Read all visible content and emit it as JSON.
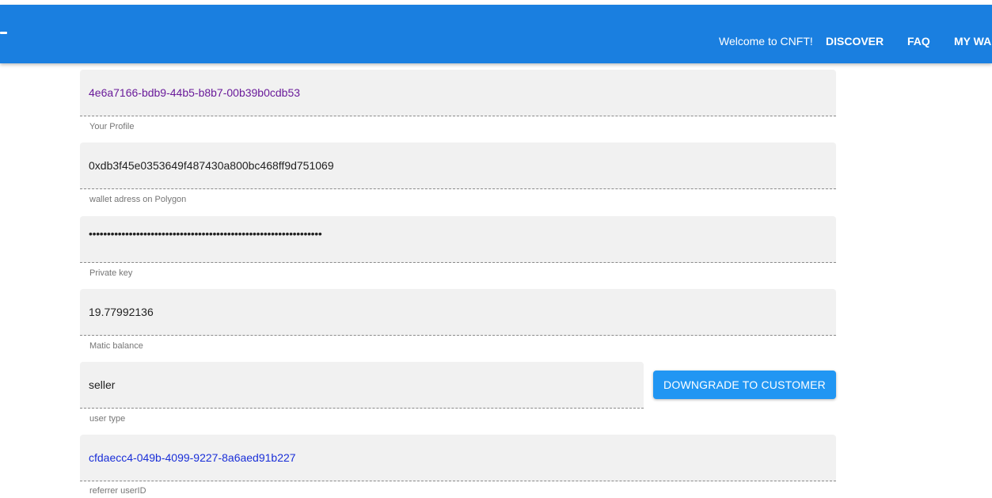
{
  "header": {
    "welcome_text": "Welcome to CNFT!",
    "nav": {
      "discover": "DISCOVER",
      "faq": "FAQ",
      "my_wallet": "MY WA"
    },
    "background_color": "#1a7fe0"
  },
  "profile_form": {
    "profile_id": {
      "value": "4e6a7166-bdb9-44b5-b8b7-00b39b0cdb53",
      "helper": "Your Profile"
    },
    "wallet_address": {
      "value": "0xdb3f45e0353649f487430a800bc468ff9d751069",
      "helper": "wallet adress on Polygon"
    },
    "private_key": {
      "value": "••••••••••••••••••••••••••••••••••••••••••••••••••••••••••••••••",
      "helper": "Private key"
    },
    "matic_balance": {
      "value": "19.77992136",
      "helper": "Matic balance"
    },
    "user_type": {
      "value": "seller",
      "helper": "user type",
      "action_label": "DOWNGRADE TO CUSTOMER"
    },
    "referrer": {
      "value": "cfdaecc4-049b-4099-9227-8a6aed91b227",
      "helper": "referrer userID"
    }
  },
  "colors": {
    "accent_button": "#2196f3",
    "profile_link": "#6a1b9a",
    "referrer_link": "#1a2fd8"
  }
}
